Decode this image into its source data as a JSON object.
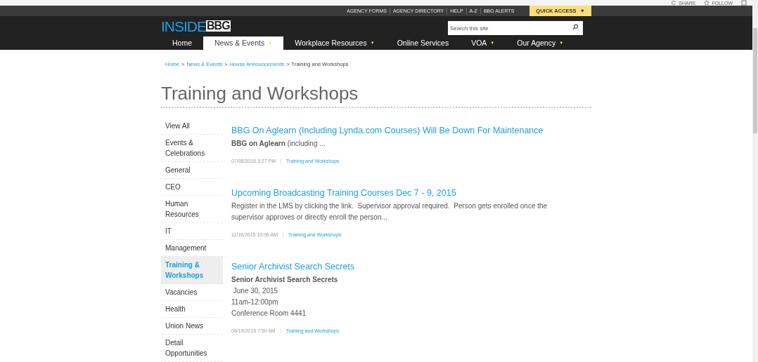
{
  "ribbon": {
    "actions": [
      {
        "kind": "share",
        "label": "SHARE"
      },
      {
        "kind": "follow",
        "label": "FOLLOW"
      },
      {
        "kind": "focus"
      }
    ]
  },
  "top_links": [
    "AGENCY FORMS",
    "AGENCY DIRECTORY",
    "HELP",
    "A-Z",
    "BBG ALERTS"
  ],
  "quick_access": {
    "label": "QUICK ACCESS",
    "caret": "▼"
  },
  "logo": {
    "part_1": "INSIDE",
    "part_2": "BBG"
  },
  "search": {
    "placeholder": "Search this site"
  },
  "nav": [
    {
      "label": "Home",
      "selected": false
    },
    {
      "label": "News & Events",
      "selected": true,
      "caret": "▼"
    },
    {
      "label": "Workplace Resources",
      "selected": false,
      "caret": "▼"
    },
    {
      "label": "Online Services",
      "selected": false
    },
    {
      "label": "VOA",
      "selected": false,
      "caret": "▼"
    },
    {
      "label": "Our Agency",
      "selected": false,
      "caret": "▼"
    }
  ],
  "breadcrumb": [
    {
      "label": "Home",
      "link": true
    },
    {
      "label": "News & Events",
      "link": true
    },
    {
      "label": "House Announcements",
      "link": true
    },
    {
      "label": "Training and Workshops",
      "link": false
    }
  ],
  "breadcrumb_separator": ">",
  "page_title": "Training and Workshops",
  "sidebar": {
    "items": [
      {
        "label": "View All",
        "selected": false
      },
      {
        "label": "Events & Celebrations",
        "selected": false
      },
      {
        "label": "General",
        "selected": false
      },
      {
        "label": "CEO",
        "selected": false
      },
      {
        "label": "Human Resources",
        "selected": false
      },
      {
        "label": "IT",
        "selected": false
      },
      {
        "label": "Management",
        "selected": false
      },
      {
        "label": "Training & Workshops",
        "selected": true
      },
      {
        "label": "Vacancies",
        "selected": false
      },
      {
        "label": "Health",
        "selected": false
      },
      {
        "label": "Union News",
        "selected": false
      },
      {
        "label": "Detail Opportunities",
        "selected": false
      }
    ]
  },
  "posts": [
    {
      "title": "BBG On Aglearn (Including Lynda.com Courses) Will Be Down For Maintenance",
      "lines": [
        {
          "kind": "text",
          "text": "**BBG on Aglearn** (including ..."
        }
      ],
      "date": "07/08/2016 3:27 PM",
      "category": "Training and Workshops"
    },
    {
      "title": "Upcoming Broadcasting Training Courses Dec 7 - 9, 2015",
      "lines": [
        {
          "kind": "text",
          "text": "Register in the LMS by clicking the link.  Supervisor approval required.  Person gets enrolled once the supervisor approves or directly enroll the person..."
        }
      ],
      "date": "11/16/2015 10:06 AM",
      "category": "Training and Workshops"
    },
    {
      "title": "Senior Archivist Search Secrets",
      "lines": [
        {
          "kind": "lead",
          "text": "Senior Archivist Search Secrets"
        },
        {
          "kind": "text",
          "text": " June 30, 2015"
        },
        {
          "kind": "text",
          "text": "11am-12:00pm"
        },
        {
          "kind": "text",
          "text": "Conference Room 4441"
        }
      ],
      "date": "06/19/2015 7:50 AM",
      "category": "Training and Workshops"
    }
  ]
}
